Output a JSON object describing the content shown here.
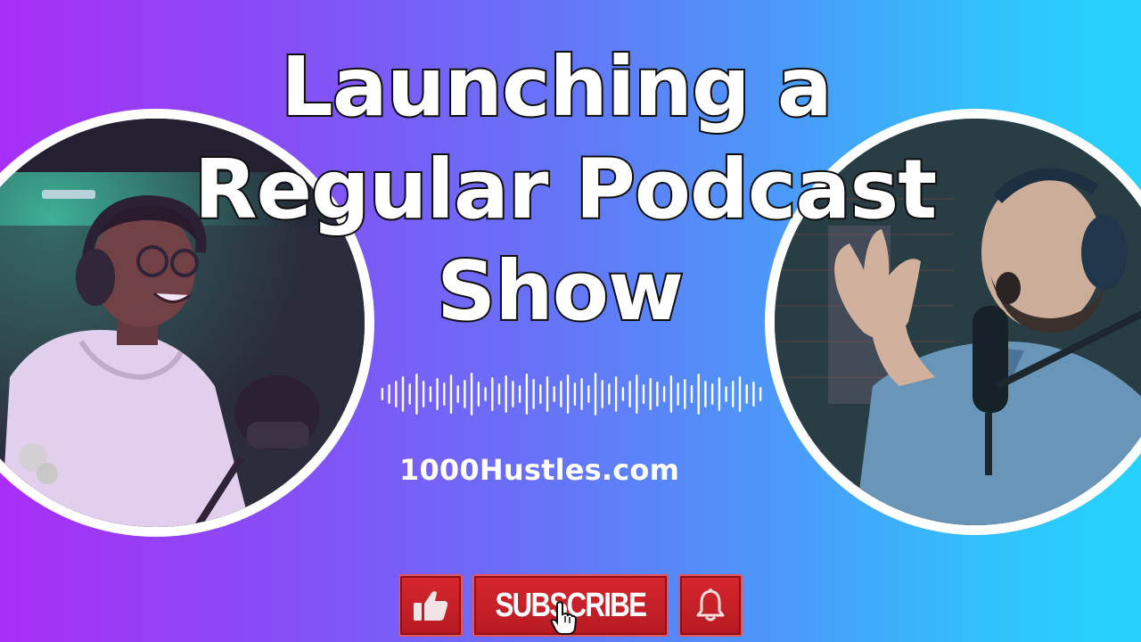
{
  "thumbnail": {
    "title_lines": [
      "Launching a",
      "Regular Podcast",
      "Show"
    ],
    "website": "1000Hustles.com",
    "subscribe_label": "SUBSCRIBE"
  },
  "icons": {
    "like": "thumbs-up-icon",
    "cursor": "hand-cursor-icon",
    "bell": "bell-icon",
    "soundwave": "sound-wave-icon"
  },
  "colors": {
    "gradient_left": "#a92ef7",
    "gradient_right": "#25d3fd",
    "button_red": "#c81f27",
    "text": "#ffffff"
  }
}
